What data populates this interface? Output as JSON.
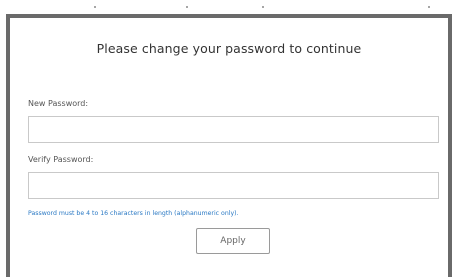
{
  "dialog": {
    "title": "Please change your password to continue",
    "new_password_label": "New Password:",
    "new_password_value": "",
    "verify_password_label": "Verify Password:",
    "verify_password_value": "",
    "hint": "Password must be 4 to 16 characters in length (alphanumeric only).",
    "apply_label": "Apply"
  },
  "colors": {
    "frame": "#6a6a6a",
    "hint": "#2a79c4",
    "input_border": "#c9c9c9"
  }
}
